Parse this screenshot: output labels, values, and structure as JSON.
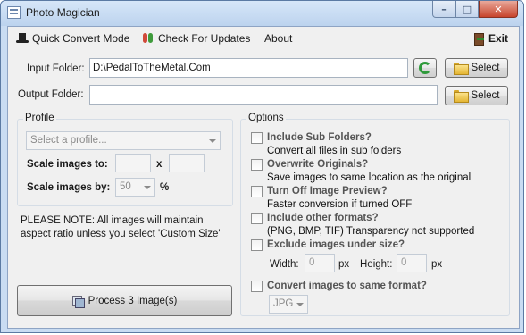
{
  "window": {
    "title": "Photo Magician"
  },
  "menu": {
    "quick_convert": "Quick Convert Mode",
    "check_updates": "Check For Updates",
    "about": "About",
    "exit": "Exit"
  },
  "folders": {
    "input_label": "Input Folder:",
    "input_value": "D:\\PedalToTheMetal.Com",
    "output_label": "Output Folder:",
    "output_value": "",
    "select_label": "Select"
  },
  "profile": {
    "group_title": "Profile",
    "select_placeholder": "Select a profile...",
    "scale_to_label": "Scale images to:",
    "scale_to_width": "",
    "scale_to_height": "",
    "times": "x",
    "scale_by_label": "Scale images by:",
    "scale_by_value": "50",
    "percent": "%"
  },
  "note": "PLEASE NOTE: All images will maintain aspect ratio unless you select 'Custom Size'",
  "process_button": "Process 3 Image(s)",
  "options": {
    "group_title": "Options",
    "items": [
      {
        "title": "Include Sub Folders?",
        "desc": "Convert all files in sub folders",
        "checked": false
      },
      {
        "title": "Overwrite Originals?",
        "desc": "Save images to same location as the original",
        "checked": false
      },
      {
        "title": "Turn Off Image Preview?",
        "desc": "Faster conversion if turned OFF",
        "checked": false
      },
      {
        "title": "Include other formats?",
        "desc": "(PNG, BMP, TIF) Transparency not supported",
        "checked": false
      },
      {
        "title": "Exclude images under size?",
        "desc": "",
        "checked": false
      },
      {
        "title": "Convert images to same format?",
        "desc": "",
        "checked": false
      }
    ],
    "width_label": "Width:",
    "width_value": "0",
    "height_label": "Height:",
    "height_value": "0",
    "px": "px",
    "format_value": "JPG"
  }
}
